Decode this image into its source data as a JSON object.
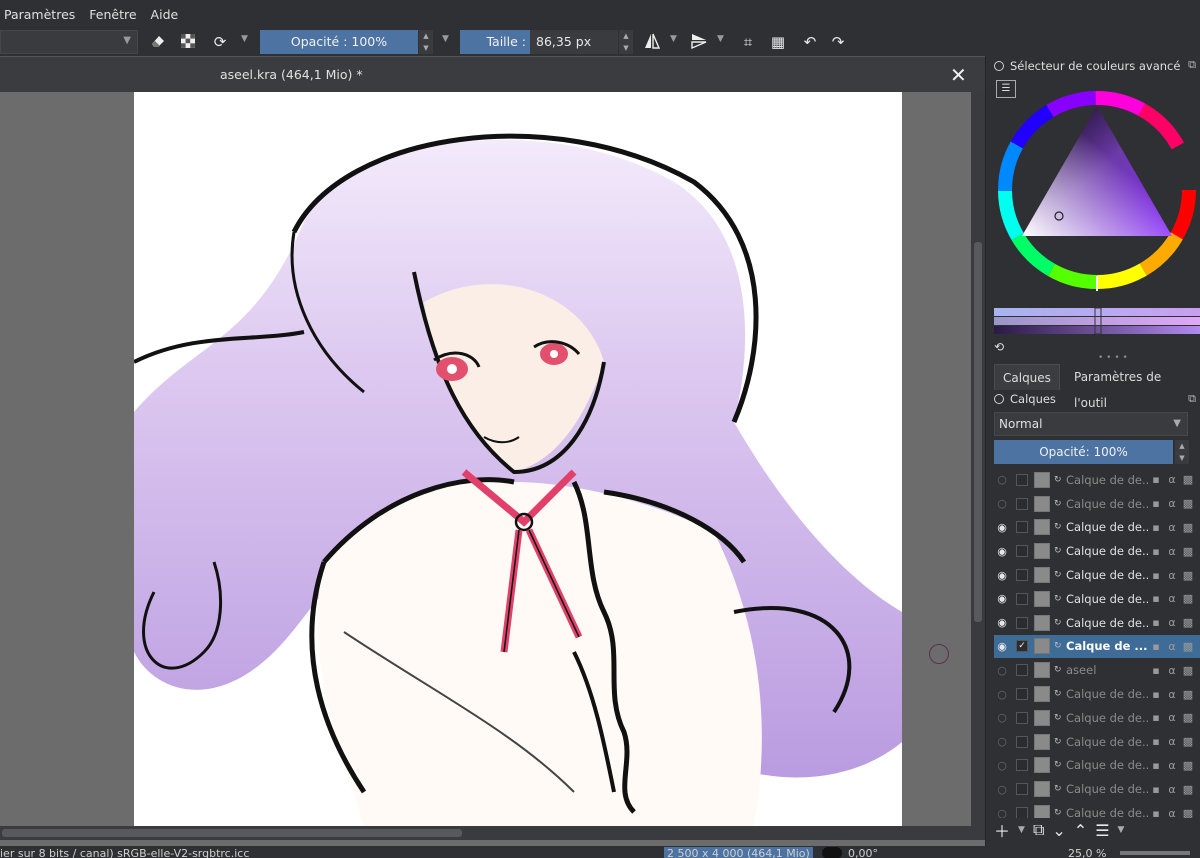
{
  "menu": {
    "items": [
      "Paramètres",
      "Fenêtre",
      "Aide"
    ]
  },
  "toolbar": {
    "opacity_label": "Opacité : 100%",
    "size_label": "Taille :",
    "size_value": "86,35 px"
  },
  "document": {
    "tab_title": "aseel.kra (464,1 Mio) *"
  },
  "color_selector": {
    "title": "Sélecteur de couleurs avancé"
  },
  "tabs": {
    "layers": "Calques",
    "tool_options": "Paramètres de l'outil"
  },
  "layers_panel": {
    "title": "Calques",
    "blend_mode": "Normal",
    "opacity_label": "Opacité:  100%",
    "layers": [
      {
        "name": "Calque de de...",
        "visible": false,
        "checked": false,
        "selected": false
      },
      {
        "name": "Calque de de...",
        "visible": false,
        "checked": false,
        "selected": false
      },
      {
        "name": "Calque de de...",
        "visible": true,
        "checked": false,
        "selected": false
      },
      {
        "name": "Calque de de...",
        "visible": true,
        "checked": false,
        "selected": false
      },
      {
        "name": "Calque de de...",
        "visible": true,
        "checked": false,
        "selected": false
      },
      {
        "name": "Calque de de...",
        "visible": true,
        "checked": false,
        "selected": false
      },
      {
        "name": "Calque de de...",
        "visible": true,
        "checked": false,
        "selected": false
      },
      {
        "name": "Calque de ...",
        "visible": true,
        "checked": true,
        "selected": true
      },
      {
        "name": "aseel",
        "visible": false,
        "checked": false,
        "selected": false
      },
      {
        "name": "Calque de de...",
        "visible": false,
        "checked": false,
        "selected": false
      },
      {
        "name": "Calque de de...",
        "visible": false,
        "checked": false,
        "selected": false
      },
      {
        "name": "Calque de de...",
        "visible": false,
        "checked": false,
        "selected": false
      },
      {
        "name": "Calque de de...",
        "visible": false,
        "checked": false,
        "selected": false
      },
      {
        "name": "Calque de de...",
        "visible": false,
        "checked": false,
        "selected": false
      },
      {
        "name": "Calque de de...",
        "visible": false,
        "checked": false,
        "selected": false
      }
    ]
  },
  "status": {
    "left": "ier sur 8 bits / canal)  sRGB-elle-V2-srgbtrc.icc",
    "dimensions": "2 500 x 4 000 (464,1 Mio)",
    "rotation": "0,00°",
    "zoom": "25,0 %"
  },
  "colors": {
    "accent": "#4d73a3",
    "hair_purple": "#c9b2e6",
    "ribbon": "#e0406a"
  }
}
